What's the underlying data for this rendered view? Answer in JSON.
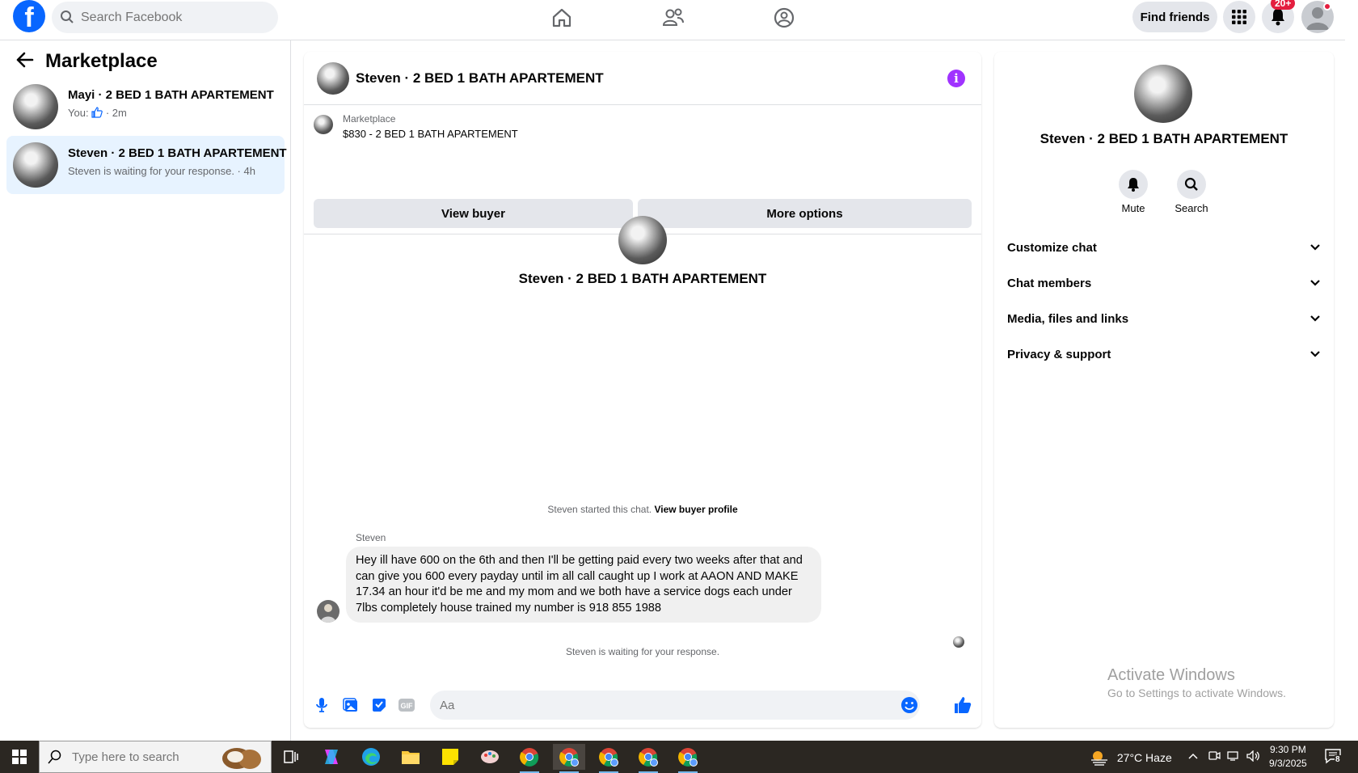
{
  "topbar": {
    "search_placeholder": "Search Facebook",
    "find_friends": "Find friends",
    "notif_badge": "20+"
  },
  "left": {
    "title": "Marketplace",
    "conversations": [
      {
        "name": "Mayi · 2 BED 1 BATH APARTEMENT",
        "sub_prefix": "You:",
        "sub_suffix": "· 2m",
        "active": false
      },
      {
        "name": "Steven · 2 BED 1 BATH APARTEMENT",
        "sub": "Steven is waiting for your response. · 4h",
        "active": true
      }
    ]
  },
  "chat": {
    "title": "Steven · 2 BED 1 BATH APARTEMENT",
    "listing_label": "Marketplace",
    "listing_price": "$830 - 2 BED 1 BATH APARTEMENT",
    "view_buyer": "View buyer",
    "more_options": "More options",
    "center_name": "Steven · 2 BED 1 BATH APARTEMENT",
    "started_text": "Steven started this chat.",
    "view_buyer_profile": "View buyer profile",
    "sender": "Steven",
    "message": "Hey ill have 600 on the 6th and then I'll be getting paid every two weeks after that and can give you 600 every payday until im all call caught up I work at AAON AND MAKE 17.34 an hour it'd be me and my mom and we both have a service dogs each under 7lbs completely house trained my number is 918 855 1988",
    "waiting_text": "Steven is waiting for your response.",
    "input_placeholder": "Aa"
  },
  "right": {
    "name": "Steven · 2 BED 1 BATH APARTEMENT",
    "mute": "Mute",
    "search": "Search",
    "sections": [
      "Customize chat",
      "Chat members",
      "Media, files and links",
      "Privacy & support"
    ]
  },
  "watermark": {
    "line1": "Activate Windows",
    "line2": "Go to Settings to activate Windows."
  },
  "taskbar": {
    "search_placeholder": "Type here to search",
    "weather": "27°C  Haze",
    "time": "9:30 PM",
    "date": "9/3/2025",
    "notif_count": "8"
  },
  "colors": {
    "brand": "#0866ff",
    "active_conv": "#e7f3ff",
    "info": "#a033ff",
    "badge": "#e41e3f"
  }
}
